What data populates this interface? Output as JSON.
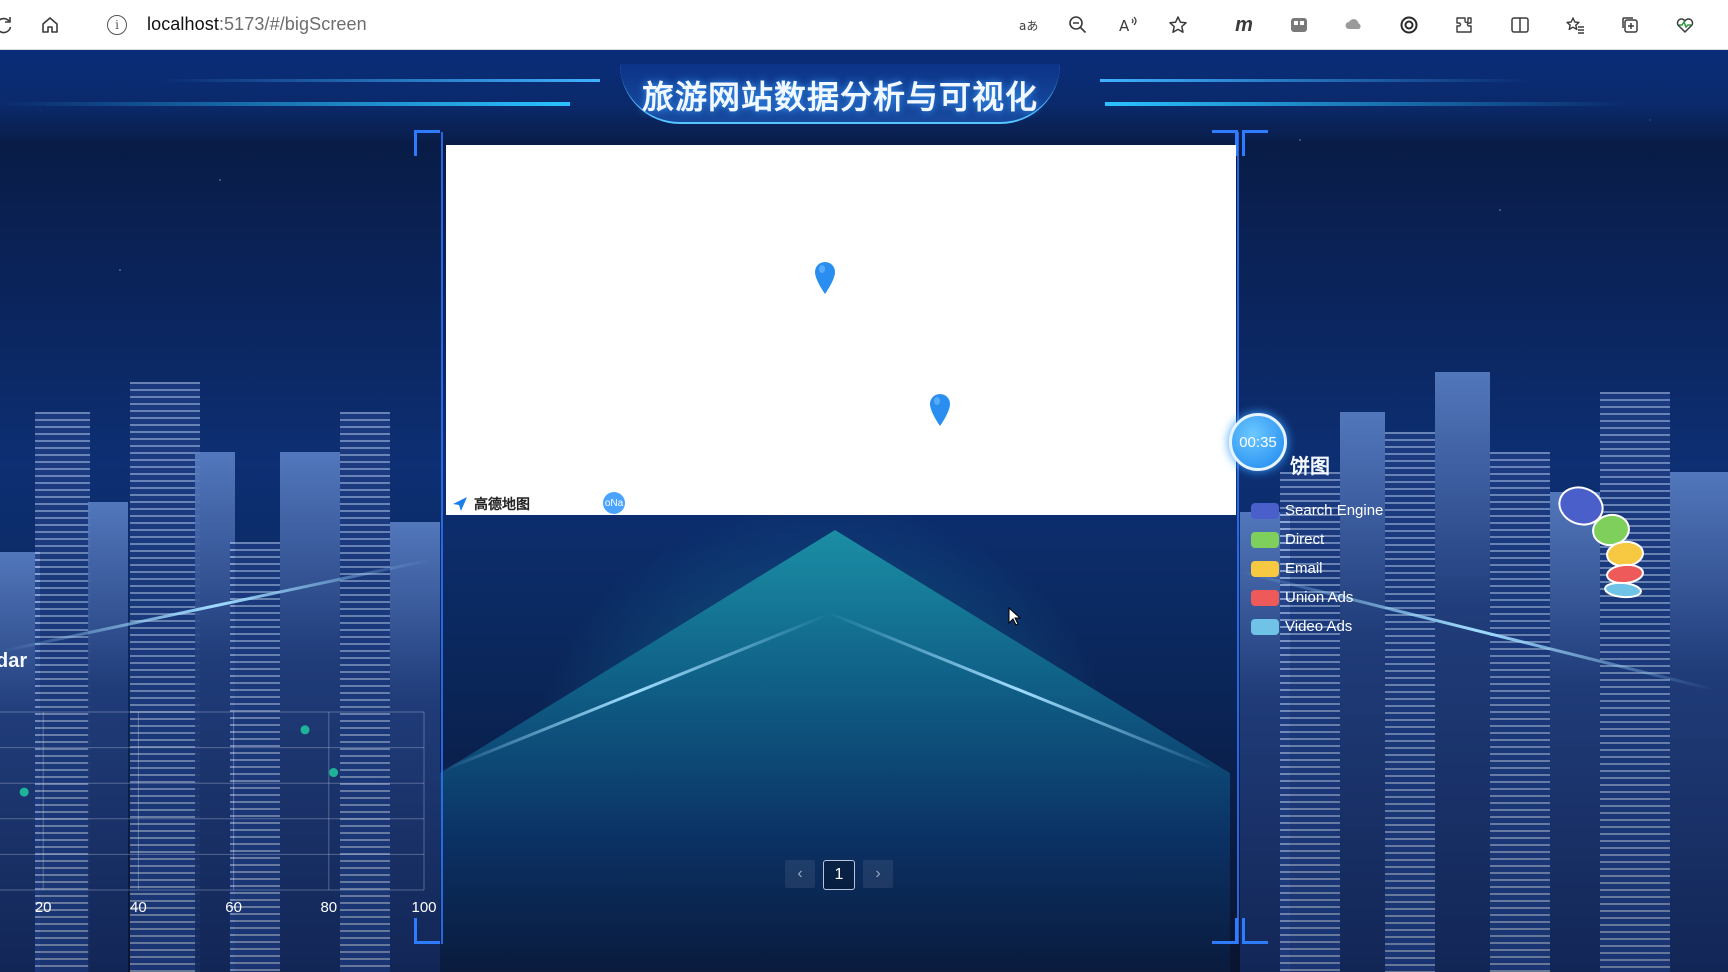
{
  "browser": {
    "url_host": "localhost",
    "url_path": ":5173/#/bigScreen",
    "toolbar_icons": [
      "refresh-icon",
      "home-icon",
      "info-icon",
      "translate-icon",
      "zoom-out-icon",
      "read-aloud-icon",
      "favorite-star-icon",
      "m-extension-icon",
      "app-extension-icon",
      "cloud-icon",
      "copilot-icon",
      "extensions-icon",
      "split-screen-icon",
      "favorites-icon",
      "collections-icon",
      "performance-icon"
    ]
  },
  "header": {
    "title": "旅游网站数据分析与可视化"
  },
  "map": {
    "provider_label": "高德地图",
    "badge_text": "oNa",
    "marker_color": "#2a8ef0"
  },
  "pagination": {
    "prev": "‹",
    "current_page": "1",
    "next": "›"
  },
  "left_panel": {
    "title": "dar",
    "chart_data": {
      "type": "scatter",
      "x_ticks": [
        "20",
        "40",
        "60",
        "80",
        "100"
      ],
      "xlim": [
        0,
        100
      ],
      "points": [
        {
          "x": 16,
          "y": 55
        },
        {
          "x": 75,
          "y": 90
        },
        {
          "x": 81,
          "y": 66
        }
      ],
      "point_color": "#1fb39a",
      "grid": true
    }
  },
  "right_panel": {
    "timer": "00:35",
    "title": "饼图",
    "chart_data": {
      "type": "pie",
      "legend": [
        {
          "label": "Search Engine",
          "color": "#4a5fc9"
        },
        {
          "label": "Direct",
          "color": "#7fcf5d"
        },
        {
          "label": "Email",
          "color": "#f7c842"
        },
        {
          "label": "Union Ads",
          "color": "#ee5a5a"
        },
        {
          "label": "Video Ads",
          "color": "#6fc3e6"
        }
      ]
    }
  },
  "colors": {
    "accent": "#2e7bff",
    "title_glow": "#3a9cff",
    "background": "#0b2660"
  }
}
